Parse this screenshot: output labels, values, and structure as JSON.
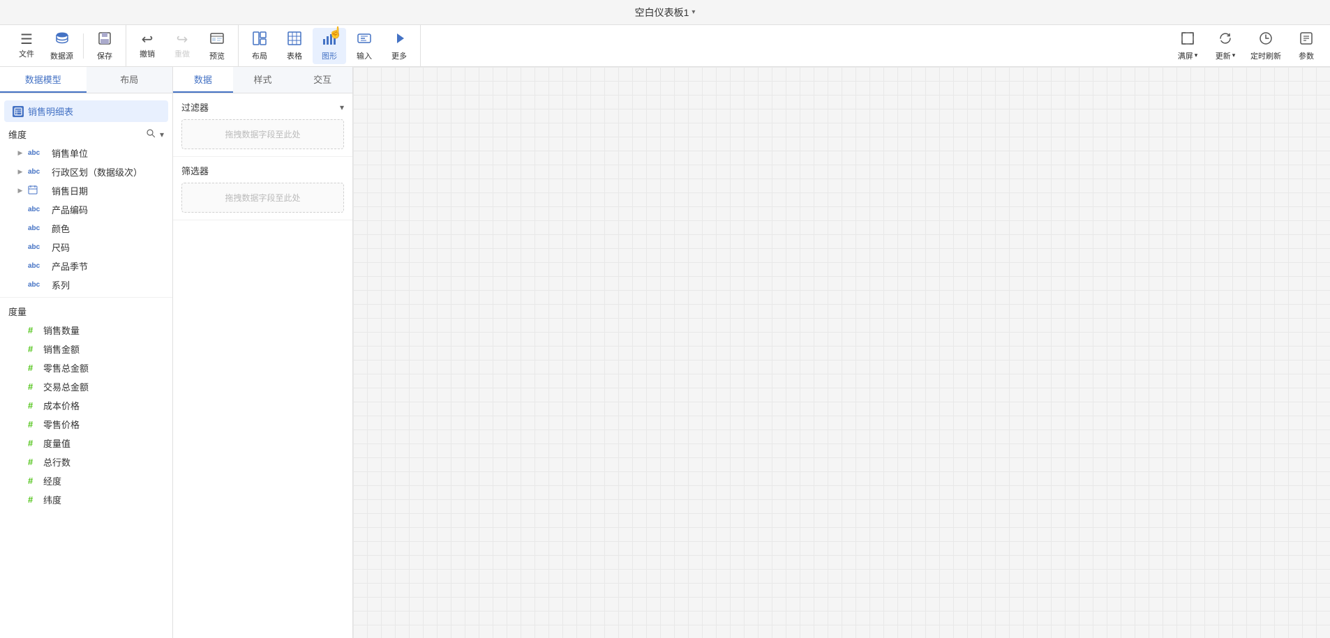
{
  "titleBar": {
    "title": "空白仪表板1",
    "dropdownArrow": "▾"
  },
  "toolbar": {
    "left": [
      {
        "id": "file",
        "icon": "≡",
        "label": "文件",
        "disabled": false
      },
      {
        "id": "datasource",
        "icon": "🗄",
        "label": "数据源",
        "disabled": false
      },
      {
        "id": "save",
        "icon": "💾",
        "label": "保存",
        "disabled": false
      }
    ],
    "middle": [
      {
        "id": "undo",
        "icon": "↩",
        "label": "撤销",
        "disabled": false
      },
      {
        "id": "redo",
        "icon": "↪",
        "label": "重做",
        "disabled": true
      },
      {
        "id": "preview",
        "icon": "📊",
        "label": "预览",
        "disabled": false
      }
    ],
    "actions": [
      {
        "id": "layout",
        "icon": "▦",
        "label": "布局",
        "active": false
      },
      {
        "id": "table",
        "icon": "⊞",
        "label": "表格",
        "active": false
      },
      {
        "id": "chart",
        "icon": "📈",
        "label": "图形",
        "active": true,
        "cursor": true
      },
      {
        "id": "input",
        "icon": "✏",
        "label": "输入",
        "active": false
      },
      {
        "id": "more",
        "icon": "▶",
        "label": "更多",
        "active": false
      }
    ],
    "right": [
      {
        "id": "fullscreen",
        "icon": "⛶",
        "label": "满屏",
        "hasArrow": true
      },
      {
        "id": "refresh",
        "icon": "⟳",
        "label": "更新",
        "hasArrow": true
      },
      {
        "id": "autoupdate",
        "icon": "⏱",
        "label": "定时刷新",
        "active": false
      },
      {
        "id": "params",
        "icon": "⊡",
        "label": "参数",
        "active": false
      }
    ]
  },
  "leftPanel": {
    "tabs": [
      {
        "id": "data-model",
        "label": "数据模型",
        "active": true
      },
      {
        "id": "layout",
        "label": "布局",
        "active": false
      }
    ],
    "tableItem": {
      "icon": "≡",
      "label": "销售明细表"
    },
    "dimensions": {
      "sectionLabel": "维度",
      "fields": [
        {
          "id": "sales-unit",
          "type": "abc",
          "typeColor": "blue",
          "name": "销售单位",
          "hasExpand": true
        },
        {
          "id": "region",
          "type": "abc",
          "typeColor": "blue",
          "name": "行政区划（数据级次）",
          "hasExpand": true
        },
        {
          "id": "sale-date",
          "type": "cal",
          "typeColor": "blue",
          "name": "销售日期",
          "hasExpand": true,
          "isCalendar": true
        },
        {
          "id": "product-code",
          "type": "abc",
          "typeColor": "blue",
          "name": "产品编码",
          "hasExpand": false
        },
        {
          "id": "color",
          "type": "abc",
          "typeColor": "blue",
          "name": "颜色",
          "hasExpand": false
        },
        {
          "id": "size",
          "type": "abc",
          "typeColor": "blue",
          "name": "尺码",
          "hasExpand": false
        },
        {
          "id": "season",
          "type": "abc",
          "typeColor": "blue",
          "name": "产品季节",
          "hasExpand": false
        },
        {
          "id": "series",
          "type": "abc",
          "typeColor": "blue",
          "name": "系列",
          "hasExpand": false
        }
      ]
    },
    "measures": {
      "sectionLabel": "度量",
      "fields": [
        {
          "id": "sales-qty",
          "name": "销售数量"
        },
        {
          "id": "sales-amount",
          "name": "销售金额"
        },
        {
          "id": "retail-total",
          "name": "零售总金额"
        },
        {
          "id": "trade-total",
          "name": "交易总金额"
        },
        {
          "id": "cost-price",
          "name": "成本价格"
        },
        {
          "id": "retail-price",
          "name": "零售价格"
        },
        {
          "id": "measure-val",
          "name": "度量值"
        },
        {
          "id": "total-rows",
          "name": "总行数"
        },
        {
          "id": "longitude",
          "name": "经度"
        },
        {
          "id": "latitude",
          "name": "纬度"
        }
      ]
    }
  },
  "middlePanel": {
    "tabs": [
      {
        "id": "data",
        "label": "数据",
        "active": true
      },
      {
        "id": "style",
        "label": "样式",
        "active": false
      },
      {
        "id": "interaction",
        "label": "交互",
        "active": false
      }
    ],
    "filterSection": {
      "label": "过滤器",
      "dropZoneText": "拖拽数据字段至此处",
      "collapsed": false
    },
    "selectorSection": {
      "label": "筛选器",
      "dropZoneText": "拖拽数据字段至此处"
    }
  },
  "canvas": {
    "isEmpty": true
  }
}
